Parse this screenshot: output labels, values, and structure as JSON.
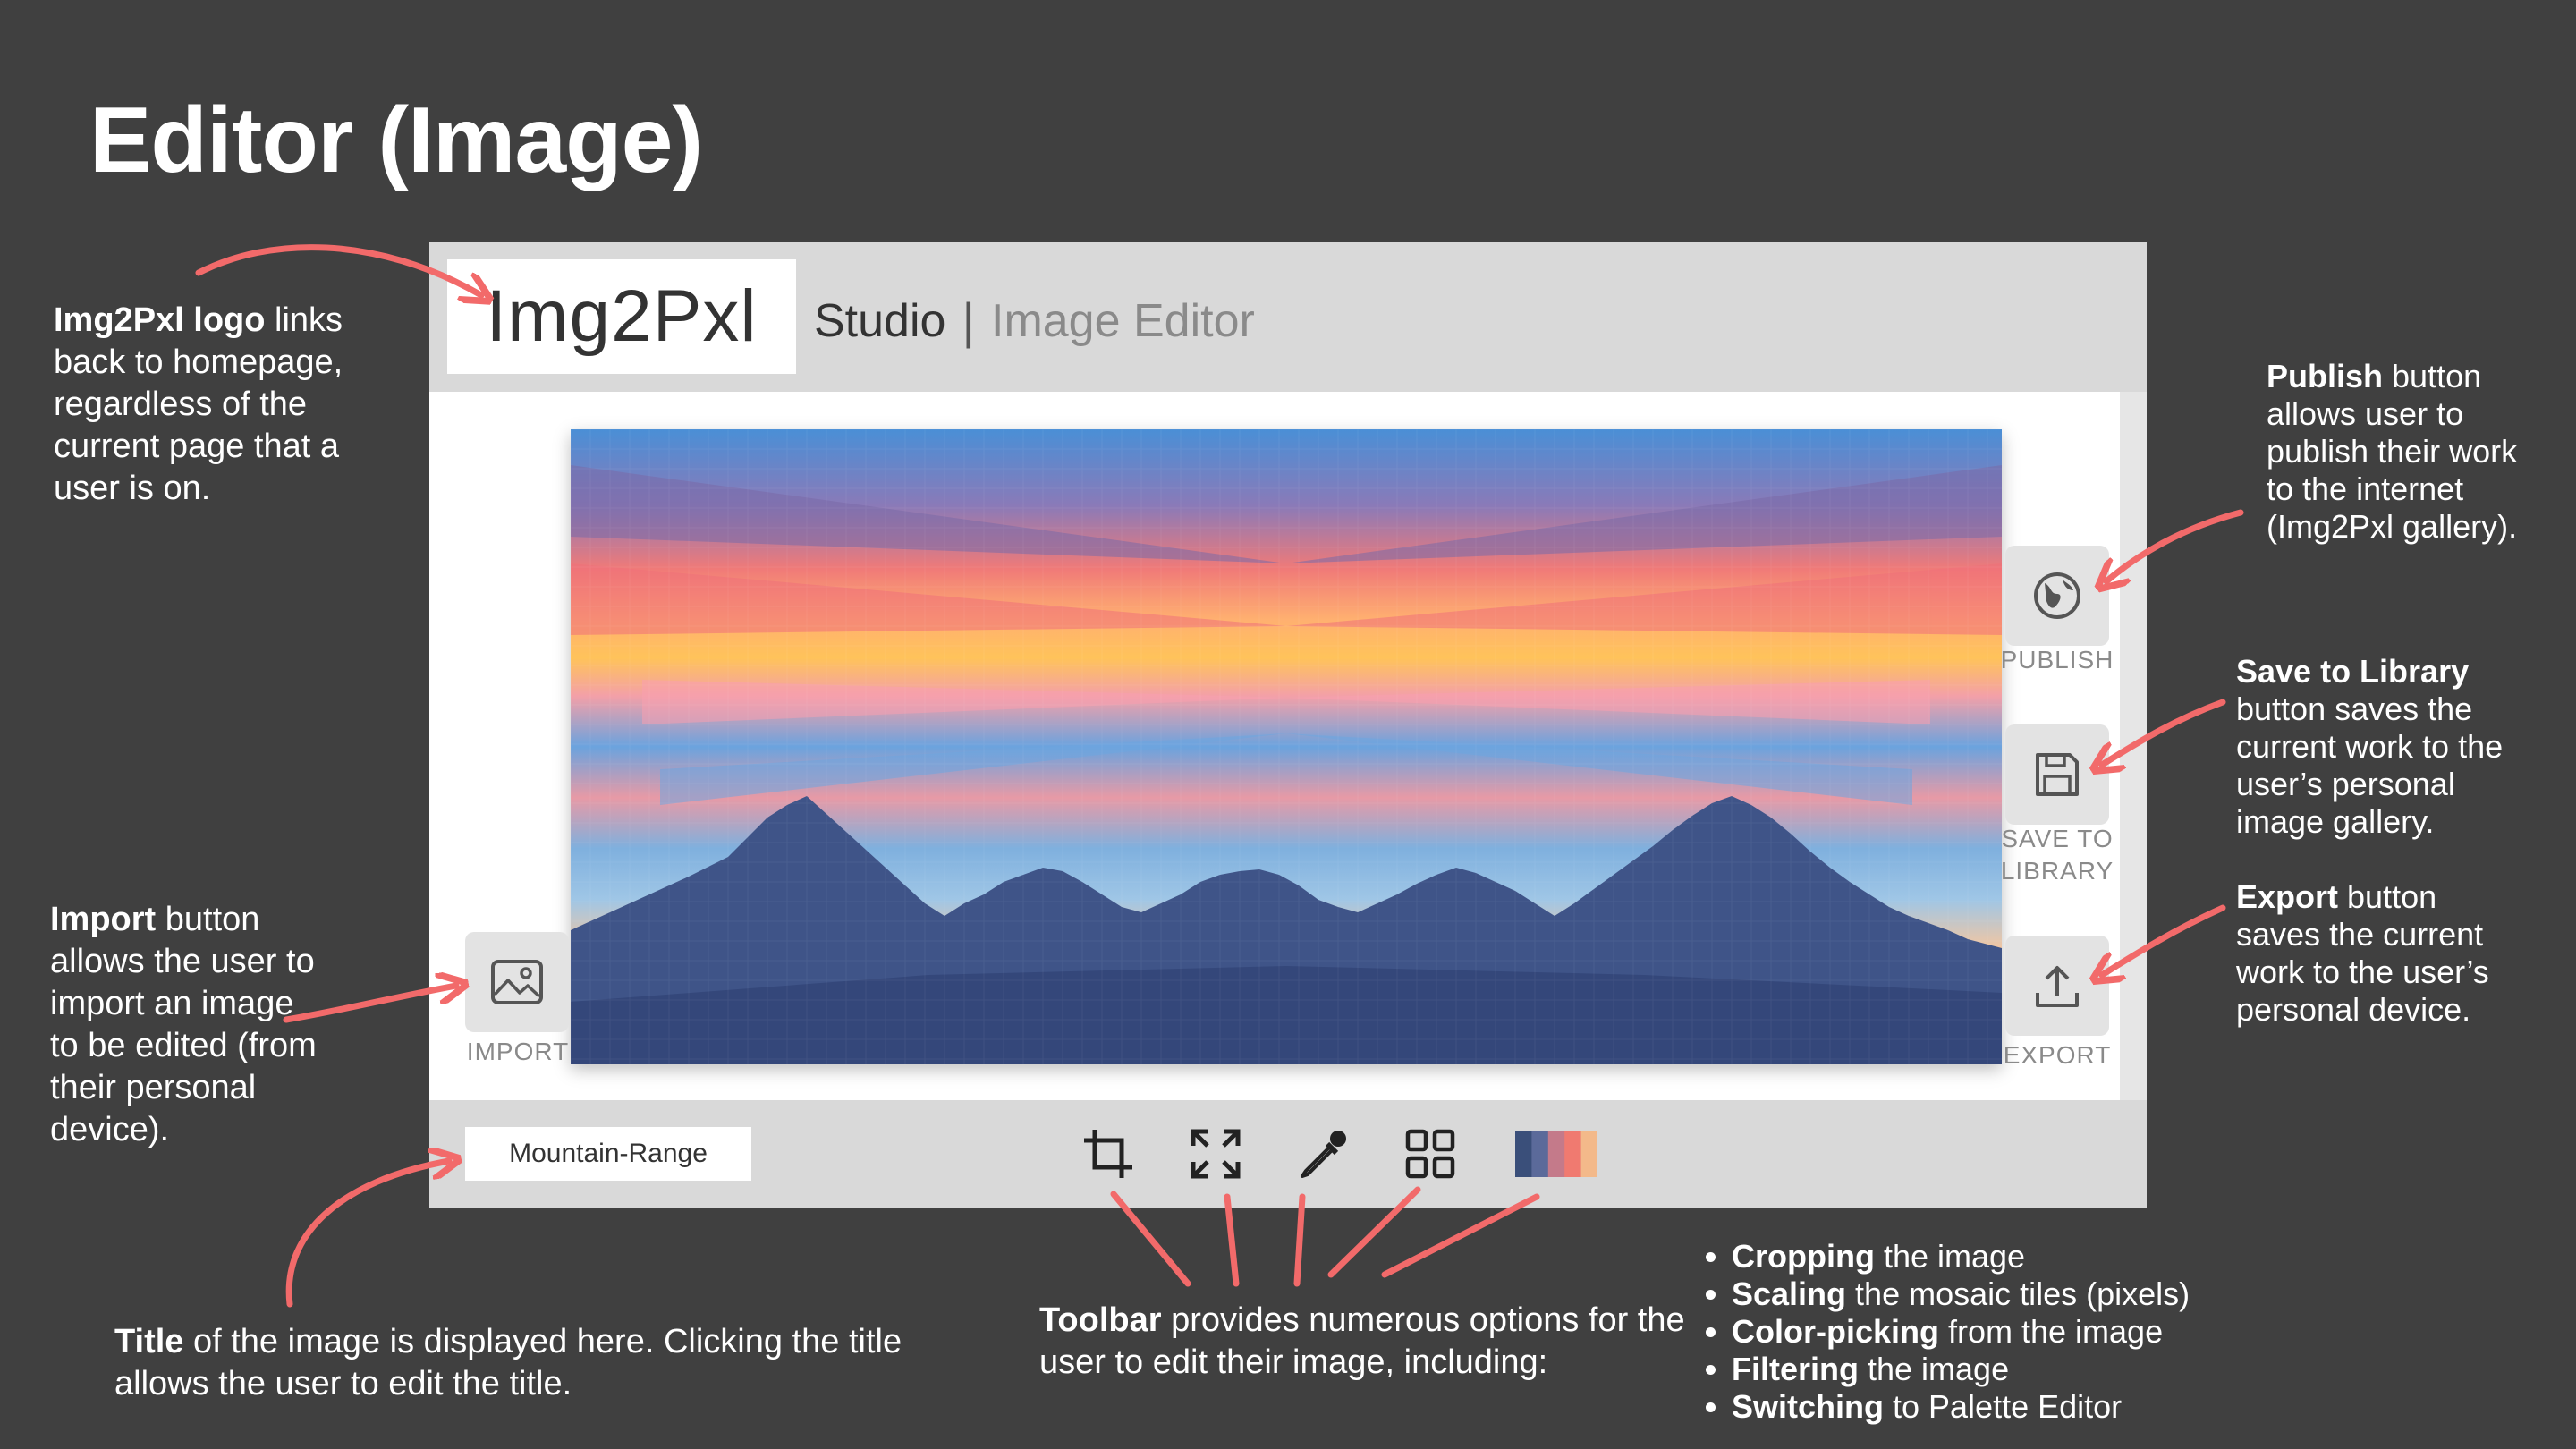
{
  "slide_title": "Editor (Image)",
  "app": {
    "logo": "Img2Pxl",
    "section": "Studio",
    "separator": "|",
    "subsection": "Image Editor",
    "buttons": {
      "import": "IMPORT",
      "publish": "PUBLISH",
      "save_line1": "SAVE TO",
      "save_line2": "LIBRARY",
      "export": "EXPORT"
    },
    "image_title": "Mountain-Range",
    "toolbar_icons": [
      "crop-icon",
      "expand-icon",
      "eyedropper-icon",
      "grid-icon",
      "palette-swatch-icon"
    ],
    "palette_colors": [
      "#3a4f7a",
      "#5b6a9a",
      "#c47a8a",
      "#f07a70",
      "#f3b98a"
    ]
  },
  "annotations": {
    "logo": {
      "bold": "Img2Pxl logo",
      "text": " links back to homepage, regardless of the current page that a user is on."
    },
    "import": {
      "bold": "Import",
      "text": " button allows the user to import an image to be edited (from their personal device)."
    },
    "title": {
      "bold": "Title",
      "text": " of the image is displayed here. Clicking the title allows the user to edit the title."
    },
    "toolbar": {
      "bold": "Toolbar",
      "text": " provides numerous options for the user to edit their image, including:"
    },
    "toolbar_items": [
      {
        "bold": "Cropping",
        "text": " the image"
      },
      {
        "bold": "Scaling",
        "text": " the mosaic tiles (pixels)"
      },
      {
        "bold": "Color-picking",
        "text": " from the image"
      },
      {
        "bold": "Filtering",
        "text": " the image"
      },
      {
        "bold": "Switching",
        "text": " to Palette Editor"
      }
    ],
    "publish": {
      "bold": "Publish",
      "text": " button allows user to publish their work to the internet (Img2Pxl gallery)."
    },
    "save": {
      "bold": "Save to Library",
      "text": " button saves the current work to the user’s personal image gallery."
    },
    "export": {
      "bold": "Export",
      "text": " button saves the current work to the user’s personal device."
    }
  },
  "colors": {
    "background": "#404040",
    "arrow": "#f26a6a",
    "panel": "#d9d9d9"
  }
}
